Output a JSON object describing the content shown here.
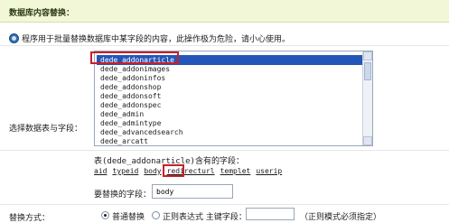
{
  "header": {
    "title": "数据库内容替换："
  },
  "notice": {
    "text": "程序用于批量替换数据库中某字段的内容，此操作极为危险，请小心使用。"
  },
  "table_select": {
    "label": "选择数据表与字段：",
    "options": [
      "dede_addonarticle",
      "dede_addonimages",
      "dede_addoninfos",
      "dede_addonshop",
      "dede_addonsoft",
      "dede_addonspec",
      "dede_admin",
      "dede_admintype",
      "dede_advancedsearch",
      "dede_arcatt"
    ],
    "selected_index": 0
  },
  "fields_info": {
    "title": "表(dede_addonarticle)含有的字段：",
    "fields": [
      "aid",
      "typeid",
      "body",
      "redirecturl",
      "templet",
      "userip"
    ]
  },
  "replace_field": {
    "label": "要替换的字段：",
    "value": "body"
  },
  "replace_mode": {
    "label": "替换方式：",
    "option_normal": "普通替换",
    "option_regex": "正则表达式 主键字段：",
    "note": "（正则模式必须指定）"
  }
}
